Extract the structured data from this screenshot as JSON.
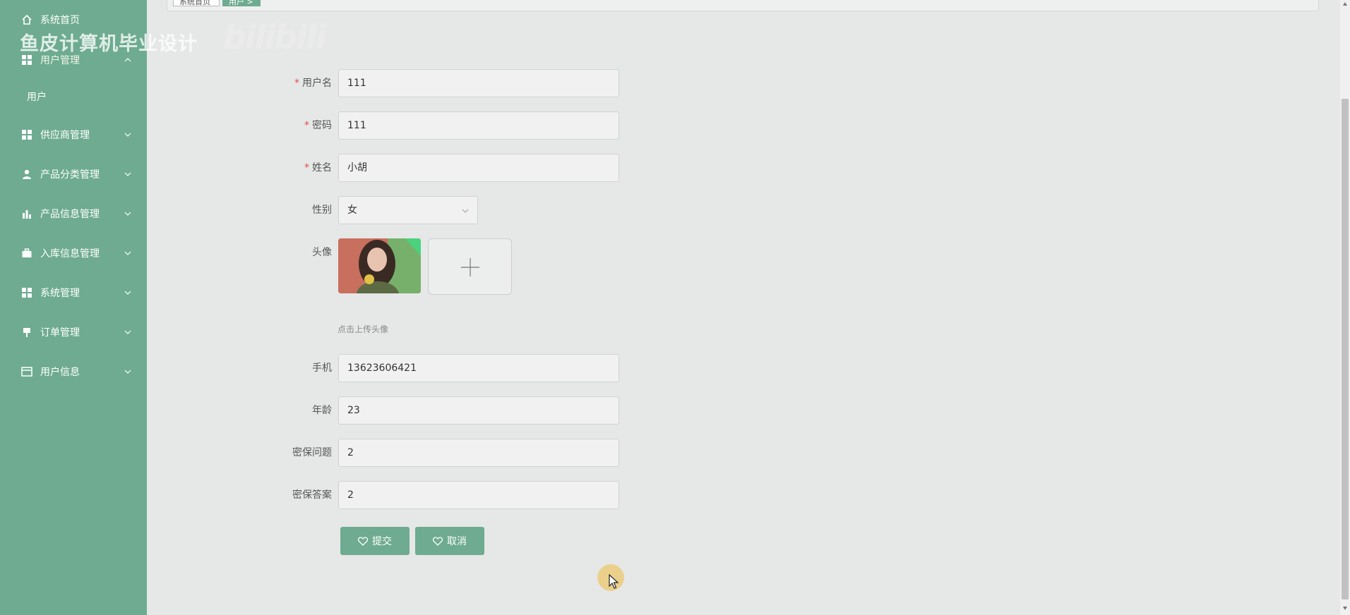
{
  "sidebar": {
    "items": [
      {
        "label": "系统首页",
        "icon": "home-icon"
      },
      {
        "label": "用户管理",
        "icon": "grid-icon"
      },
      {
        "label": "用户"
      },
      {
        "label": "供应商管理",
        "icon": "grid-icon"
      },
      {
        "label": "产品分类管理",
        "icon": "user-icon"
      },
      {
        "label": "产品信息管理",
        "icon": "bar-chart-icon"
      },
      {
        "label": "入库信息管理",
        "icon": "briefcase-icon"
      },
      {
        "label": "系统管理",
        "icon": "grid-icon"
      },
      {
        "label": "订单管理",
        "icon": "pin-icon"
      },
      {
        "label": "用户信息",
        "icon": "card-icon"
      }
    ]
  },
  "watermark": {
    "text": "鱼皮计算机毕业设计",
    "logo": "bilibili"
  },
  "breadcrumb": {
    "home": "系统首页",
    "current": "用户 >"
  },
  "form": {
    "username": {
      "label": "用户名",
      "value": "111"
    },
    "password": {
      "label": "密码",
      "value": "111"
    },
    "name": {
      "label": "姓名",
      "value": "小胡"
    },
    "gender": {
      "label": "性别",
      "value": "女"
    },
    "avatar": {
      "label": "头像",
      "hint": "点击上传头像"
    },
    "phone": {
      "label": "手机",
      "value": "13623606421"
    },
    "age": {
      "label": "年龄",
      "value": "23"
    },
    "question": {
      "label": "密保问题",
      "value": "2"
    },
    "answer": {
      "label": "密保答案",
      "value": "2"
    },
    "required_mark": "*"
  },
  "buttons": {
    "submit": "提交",
    "cancel": "取消"
  },
  "colors": {
    "accent": "#6eab91",
    "required": "#e24a4a"
  }
}
